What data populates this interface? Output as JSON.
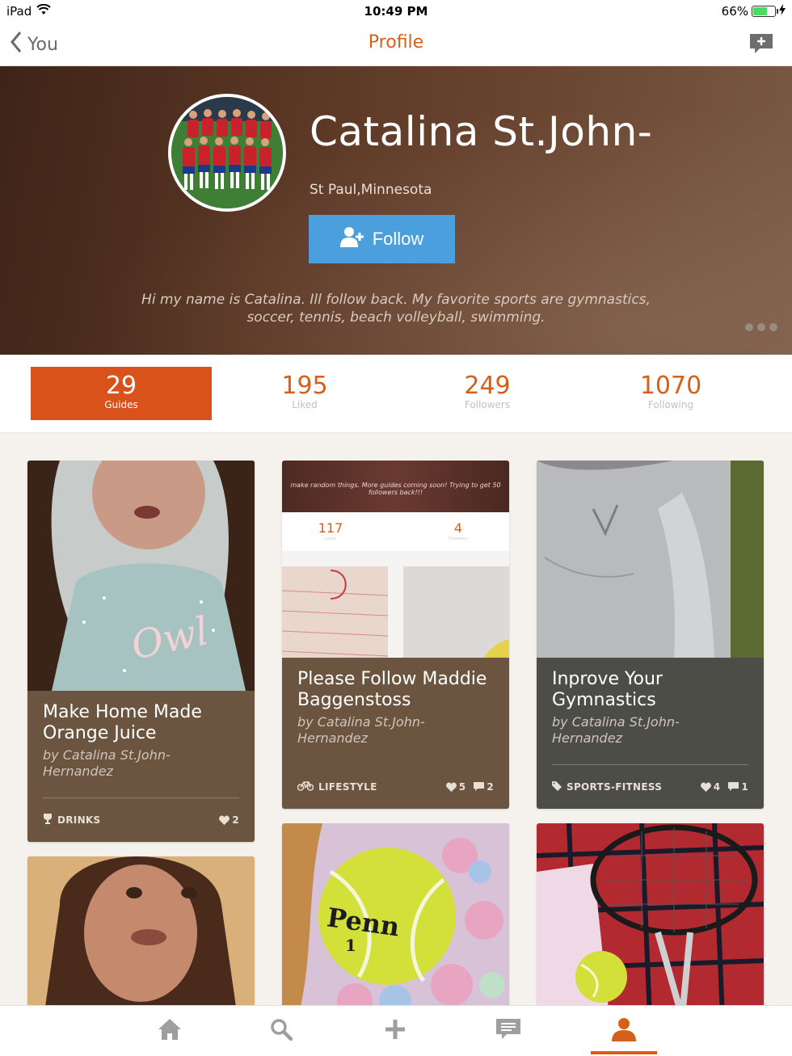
{
  "status_bar": {
    "device": "iPad",
    "time": "10:49 PM",
    "battery": "66%"
  },
  "nav": {
    "back_label": "You",
    "title": "Profile"
  },
  "profile": {
    "name": "Catalina St.John-",
    "location": "St Paul,Minnesota",
    "follow_label": "Follow",
    "bio": "Hi my name is Catalina. Ill follow back. My favorite sports are gymnastics, soccer, tennis, beach volleyball, swimming."
  },
  "stats": [
    {
      "value": "29",
      "label": "Guides"
    },
    {
      "value": "195",
      "label": "Liked"
    },
    {
      "value": "249",
      "label": "Followers"
    },
    {
      "value": "1070",
      "label": "Following"
    }
  ],
  "guides": [
    {
      "title": "Make Home Made Orange Juice",
      "author": "by Catalina St.John-Hernandez",
      "category": "DRINKS",
      "likes": "2",
      "comments": ""
    },
    {
      "title": "Please Follow Maddie Baggenstoss",
      "author": "by Catalina St.John-Hernandez",
      "category": "LIFESTYLE",
      "likes": "5",
      "comments": "2",
      "thumb_text": "make random things. More guides coming soon! Trying to get 50 followers back!!!",
      "thumb_liked": "117",
      "thumb_liked_label": "Liked",
      "thumb_followers": "4",
      "thumb_followers_label": "Followers"
    },
    {
      "title": "Inprove Your Gymnastics",
      "author": "by Catalina St.John-Hernandez",
      "category": "SPORTS-FITNESS",
      "likes": "4",
      "comments": "1"
    }
  ],
  "ball_text": {
    "brand": "Penn",
    "number": "1"
  },
  "colors": {
    "accent": "#d6601a",
    "follow": "#4a9fdc",
    "active_stat": "#d9511b"
  }
}
